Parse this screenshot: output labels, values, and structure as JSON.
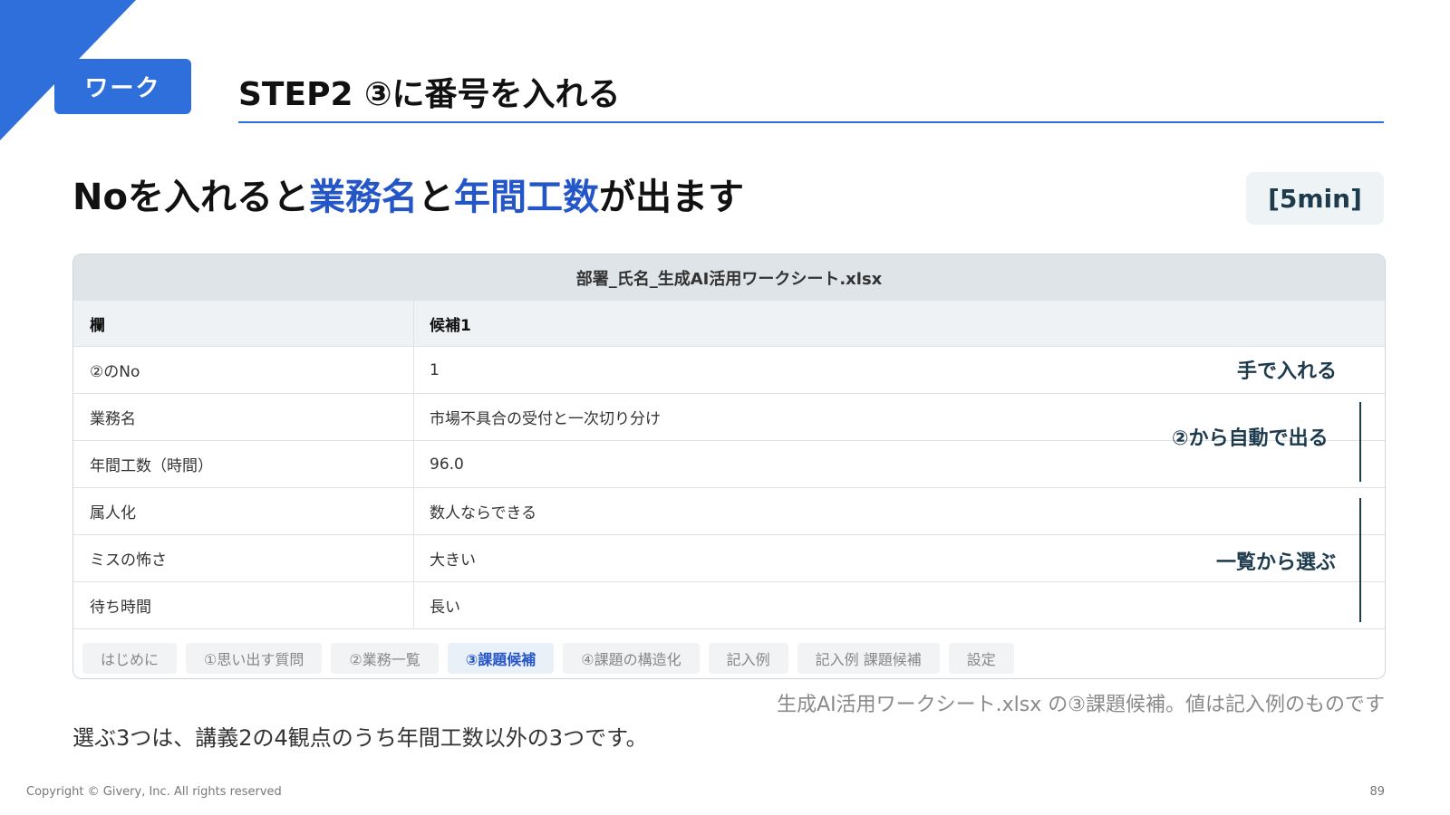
{
  "header": {
    "badge": "ワーク",
    "title": "STEP2 ③に番号を入れる"
  },
  "headline": {
    "part1": "Noを入れると",
    "highlight1": "業務名",
    "part2": "と",
    "highlight2": "年間工数",
    "part3": "が出ます"
  },
  "time_badge": "[5min]",
  "sheet": {
    "filename": "部署_氏名_生成AI活用ワークシート.xlsx",
    "columns": [
      "欄",
      "候補1"
    ],
    "rows": [
      {
        "label": "②のNo",
        "value": "1"
      },
      {
        "label": "業務名",
        "value": "市場不具合の受付と一次切り分け"
      },
      {
        "label": "年間工数（時間）",
        "value": "96.0"
      },
      {
        "label": "属人化",
        "value": "数人ならできる"
      },
      {
        "label": "ミスの怖さ",
        "value": "大きい"
      },
      {
        "label": "待ち時間",
        "value": "長い"
      }
    ],
    "tabs": [
      {
        "label": "はじめに",
        "active": false
      },
      {
        "label": "①思い出す質問",
        "active": false
      },
      {
        "label": "②業務一覧",
        "active": false
      },
      {
        "label": "③課題候補",
        "active": true
      },
      {
        "label": "④課題の構造化",
        "active": false
      },
      {
        "label": "記入例",
        "active": false
      },
      {
        "label": "記入例 課題候補",
        "active": false
      },
      {
        "label": "設定",
        "active": false
      }
    ]
  },
  "notes": {
    "manual": "手で入れる",
    "auto": "②から自動で出る",
    "select": "一覧から選ぶ"
  },
  "caption": "生成AI活用ワークシート.xlsx の③課題候補。値は記入例のものです",
  "body_text": "選ぶ3つは、講義2の4観点のうち年間工数以外の3つです。",
  "footer": {
    "copyright": "Copyright © Givery, Inc. All rights reserved",
    "page": "89"
  },
  "colors": {
    "accent": "#2f6fdb",
    "highlight": "#2456c8",
    "note": "#1d3b4d"
  }
}
